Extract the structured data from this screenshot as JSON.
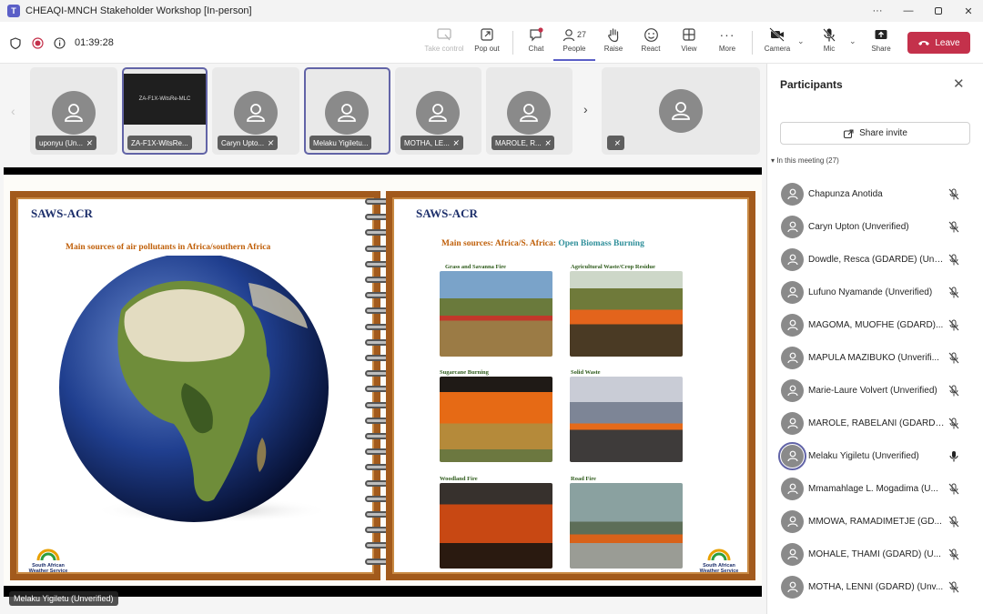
{
  "window": {
    "title": "CHEAQI-MNCH Stakeholder Workshop [In-person]"
  },
  "meeting": {
    "timer": "01:39:28",
    "people_count": "27"
  },
  "toolbar": {
    "take_control": "Take control",
    "pop_out": "Pop out",
    "chat": "Chat",
    "people": "People",
    "raise": "Raise",
    "react": "React",
    "view": "View",
    "more": "More",
    "camera": "Camera",
    "mic": "Mic",
    "share": "Share",
    "leave": "Leave"
  },
  "tiles": [
    {
      "name": "uponyu (Un..."
    },
    {
      "name": "ZA-F1X-WitsRe...",
      "screen_text": "ZA-F1X-WitsRe-MLC"
    },
    {
      "name": "Caryn Upto..."
    },
    {
      "name": "Melaku Yigiletu..."
    },
    {
      "name": "MOTHA, LE..."
    },
    {
      "name": "MAROLE, R..."
    },
    {
      "name": ""
    }
  ],
  "slide": {
    "left_brand": "SAWS-ACR",
    "left_heading": "Main sources of air pollutants in Africa/southern Africa",
    "right_brand": "SAWS-ACR",
    "right_heading_a": "Main sources: Africa/S. Africa: ",
    "right_heading_b": "Open Biomass Burning",
    "photos": [
      "Grass and Savanna Fire",
      "Agricultural Waste/Crop Residue",
      "Sugarcane Burning",
      "Solid Waste",
      "Woodland Fire",
      "Road Fire"
    ],
    "logo_text_1": "South African",
    "logo_text_2": "Weather Service"
  },
  "presenter_label": "Melaku Yigiletu (Unverified)",
  "panel": {
    "title": "Participants",
    "share_invite": "Share invite",
    "section": "In this meeting (27)",
    "participants": [
      {
        "name": "Chapunza Anotida",
        "mic": "muted"
      },
      {
        "name": "Caryn Upton (Unverified)",
        "mic": "muted"
      },
      {
        "name": "Dowdle, Resca (GDARDE) (Unv...",
        "mic": "muted"
      },
      {
        "name": "Lufuno Nyamande (Unverified)",
        "mic": "muted"
      },
      {
        "name": "MAGOMA, MUOFHE (GDARD)...",
        "mic": "muted"
      },
      {
        "name": "MAPULA MAZIBUKO (Unverifi...",
        "mic": "muted"
      },
      {
        "name": "Marie-Laure Volvert (Unverified)",
        "mic": "muted"
      },
      {
        "name": "MAROLE, RABELANI (GDARD) ...",
        "mic": "muted"
      },
      {
        "name": "Melaku Yigiletu (Unverified)",
        "mic": "on"
      },
      {
        "name": "Mmamahlage L. Mogadima (U...",
        "mic": "muted"
      },
      {
        "name": "MMOWA, RAMADIMETJE (GD...",
        "mic": "muted"
      },
      {
        "name": "MOHALE, THAMI (GDARD) (U...",
        "mic": "muted"
      },
      {
        "name": "MOTHA, LENNI (GDARD) (Unv...",
        "mic": "muted"
      }
    ]
  },
  "colors": {
    "accent": "#5b5fc7",
    "leave": "#c4314b",
    "slide_frame": "#a25a1c"
  }
}
